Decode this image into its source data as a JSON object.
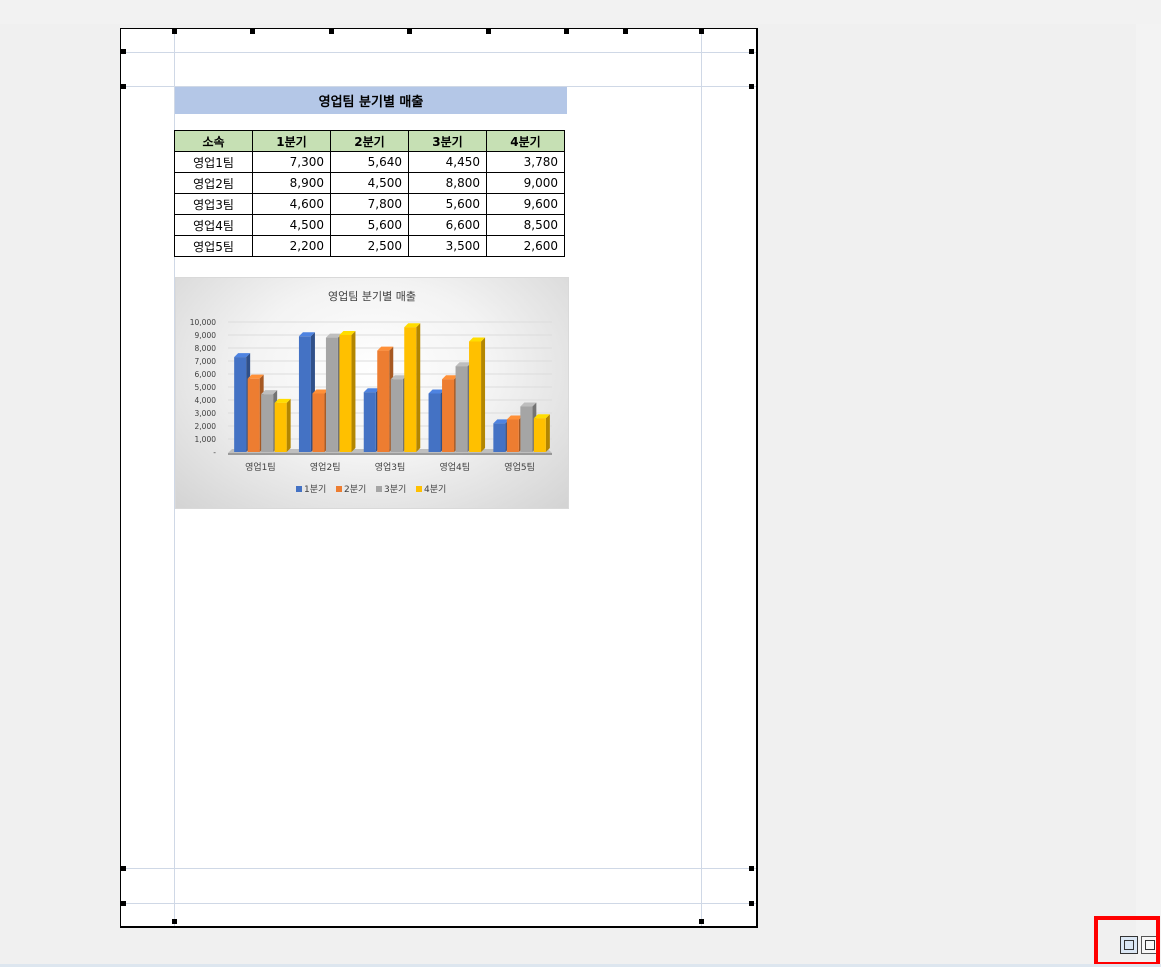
{
  "report": {
    "title": "영업팀 분기별 매출",
    "columns": [
      "소속",
      "1분기",
      "2분기",
      "3분기",
      "4분기"
    ],
    "rows": [
      {
        "team": "영업1팀",
        "values": [
          "7,300",
          "5,640",
          "4,450",
          "3,780"
        ]
      },
      {
        "team": "영업2팀",
        "values": [
          "8,900",
          "4,500",
          "8,800",
          "9,000"
        ]
      },
      {
        "team": "영업3팀",
        "values": [
          "4,600",
          "7,800",
          "5,600",
          "9,600"
        ]
      },
      {
        "team": "영업4팀",
        "values": [
          "4,500",
          "5,600",
          "6,600",
          "8,500"
        ]
      },
      {
        "team": "영업5팀",
        "values": [
          "2,200",
          "2,500",
          "3,500",
          "2,600"
        ]
      }
    ]
  },
  "chart_data": {
    "type": "bar",
    "title": "영업팀 분기별 매출",
    "categories": [
      "영업1팀",
      "영업2팀",
      "영업3팀",
      "영업4팀",
      "영업5팀"
    ],
    "series": [
      {
        "name": "1분기",
        "color": "#4472c4",
        "values": [
          7300,
          8900,
          4600,
          4500,
          2200
        ]
      },
      {
        "name": "2분기",
        "color": "#ed7d31",
        "values": [
          5640,
          4500,
          7800,
          5600,
          2500
        ]
      },
      {
        "name": "3분기",
        "color": "#a5a5a5",
        "values": [
          4450,
          8800,
          5600,
          6600,
          3500
        ]
      },
      {
        "name": "4분기",
        "color": "#ffc000",
        "values": [
          3780,
          9000,
          9600,
          8500,
          2600
        ]
      }
    ],
    "yticks": [
      "-",
      "1,000",
      "2,000",
      "3,000",
      "4,000",
      "5,000",
      "6,000",
      "7,000",
      "8,000",
      "9,000",
      "10,000"
    ],
    "ylim": [
      0,
      10000
    ],
    "grid": true,
    "legend_position": "bottom"
  },
  "statusbar": {
    "view_buttons": [
      "page-break-view-icon",
      "page-layout-view-icon"
    ],
    "highlight_color": "#ff0000"
  }
}
